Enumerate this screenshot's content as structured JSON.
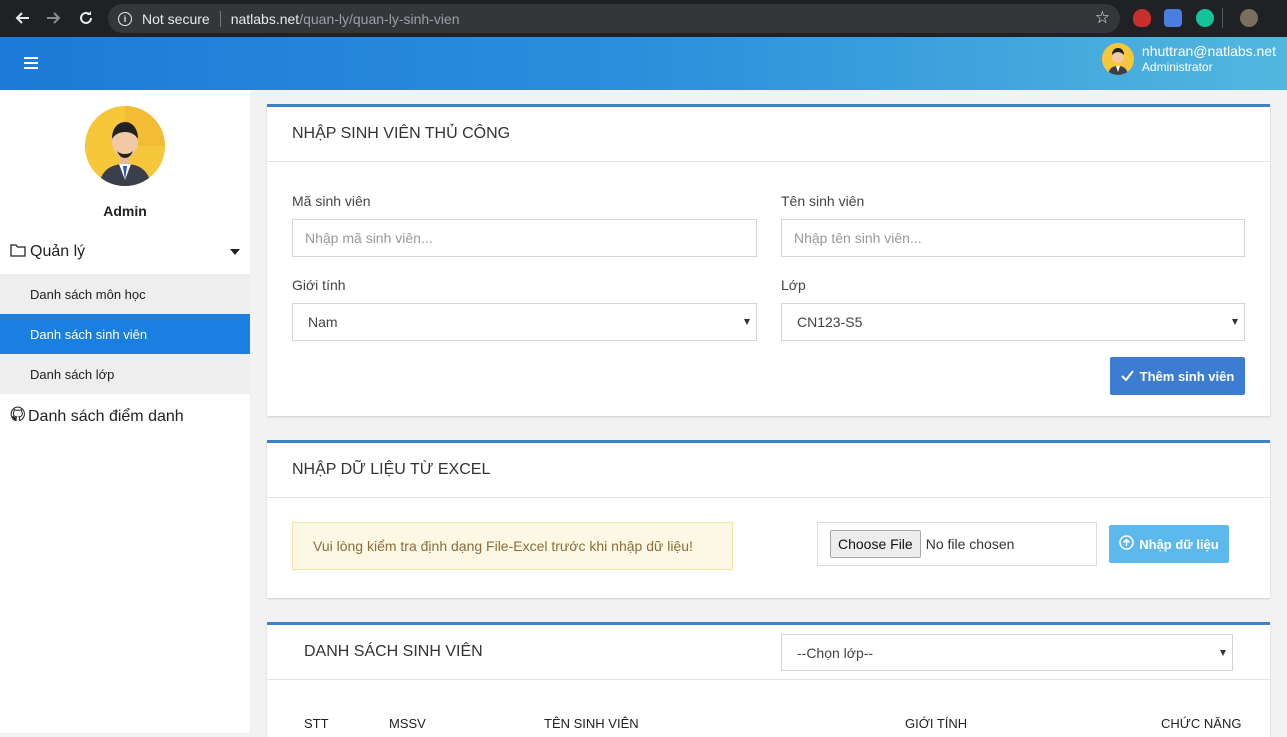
{
  "browser": {
    "security_label": "Not secure",
    "url_domain": "natlabs.net",
    "url_path": "/quan-ly/quan-ly-sinh-vien"
  },
  "header": {
    "user_email": "nhuttran@natlabs.net",
    "user_role": "Administrator"
  },
  "sidebar": {
    "profile_name": "Admin",
    "group_label": "Quản lý",
    "items": [
      {
        "label": "Danh sách môn học"
      },
      {
        "label": "Danh sách sinh viên"
      },
      {
        "label": "Danh sách lớp"
      }
    ],
    "attendance_label": "Danh sách điểm danh"
  },
  "manual": {
    "title": "NHẬP SINH VIÊN THỦ CÔNG",
    "student_id_label": "Mã sinh viên",
    "student_id_placeholder": "Nhập mã sinh viên...",
    "student_name_label": "Tên sinh viên",
    "student_name_placeholder": "Nhập tên sinh viên...",
    "gender_label": "Giới tính",
    "gender_value": "Nam",
    "class_label": "Lớp",
    "class_value": "CN123-S5",
    "add_button": "Thêm sinh viên"
  },
  "excel": {
    "title": "NHẬP DỮ LIỆU TỪ EXCEL",
    "warning": "Vui lòng kiểm tra định dạng File-Excel trước khi nhập dữ liệu!",
    "choose_file": "Choose File",
    "no_file": "No file chosen",
    "import_button": "Nhập dữ liệu"
  },
  "list": {
    "title": "DANH SÁCH SINH VIÊN",
    "class_filter": "--Chọn lớp--",
    "columns": [
      "STT",
      "MSSV",
      "TÊN SINH VIÊN",
      "GIỚI TÍNH",
      "CHỨC NĂNG"
    ]
  }
}
